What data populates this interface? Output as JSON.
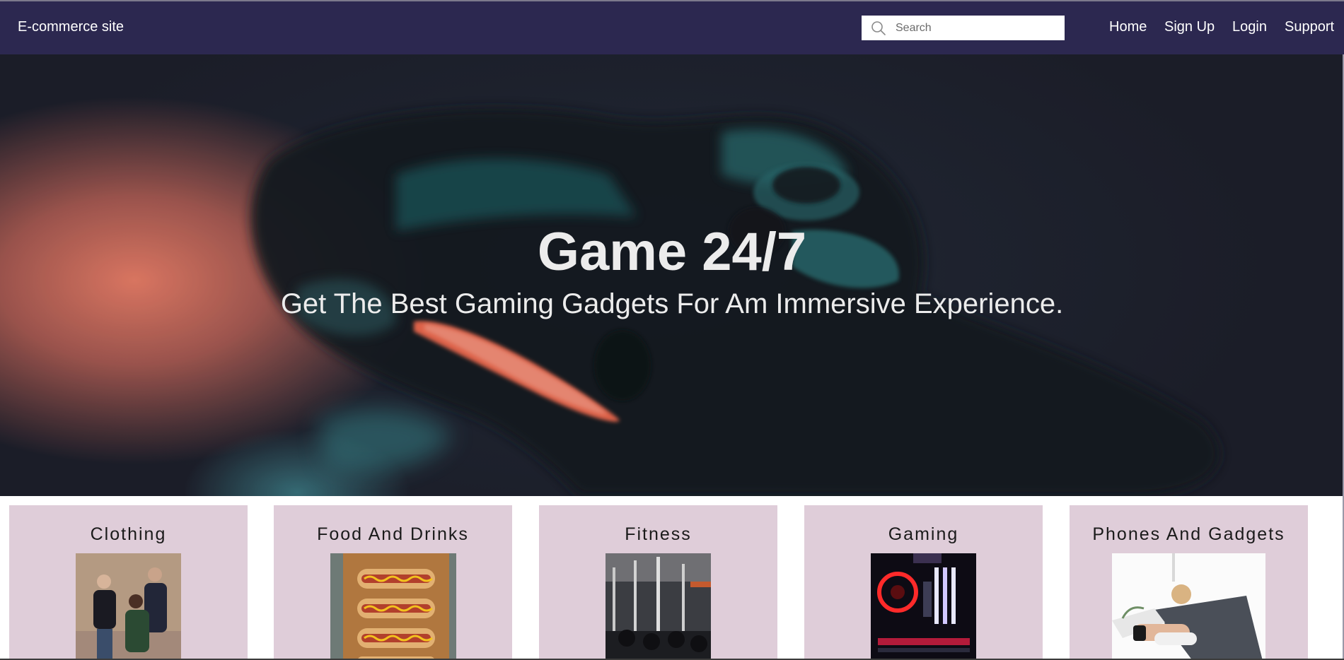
{
  "navbar": {
    "brand": "E-commerce site",
    "search": {
      "placeholder": "Search",
      "value": ""
    },
    "links": [
      "Home",
      "Sign Up",
      "Login",
      "Support"
    ]
  },
  "hero": {
    "title": "Game 24/7",
    "subtitle": "Get The Best Gaming Gadgets For Am Immersive Experience."
  },
  "categories": [
    {
      "title": "Clothing"
    },
    {
      "title": "Food And Drinks"
    },
    {
      "title": "Fitness"
    },
    {
      "title": "Gaming"
    },
    {
      "title": "Phones And Gadgets"
    }
  ],
  "colors": {
    "navbar_bg": "#2c2850",
    "card_bg": "#dfcdd9",
    "hero_text": "#ececec"
  }
}
